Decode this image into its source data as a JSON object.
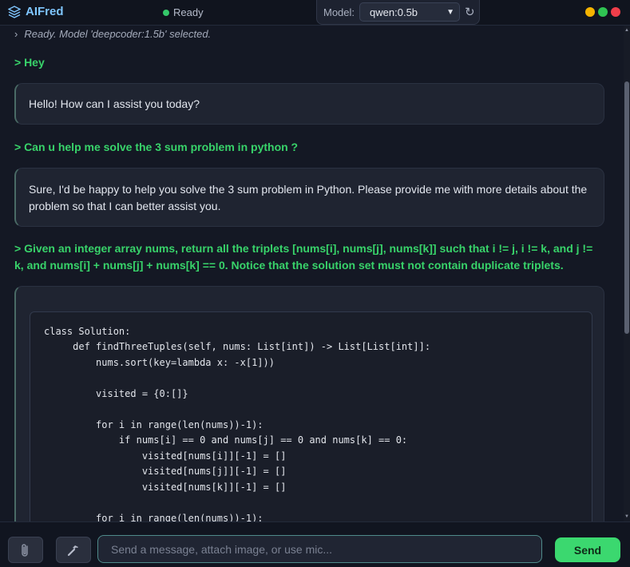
{
  "app": {
    "name": "AIFred"
  },
  "status": {
    "text": "Ready",
    "color": "#35c86a"
  },
  "model_picker": {
    "label": "Model:",
    "selected": "qwen:0.5b"
  },
  "chat": {
    "system_line": "Ready. Model 'deepcoder:1.5b' selected.",
    "messages": [
      {
        "role": "user",
        "text": "> Hey"
      },
      {
        "role": "assistant",
        "text": "Hello! How can I assist you today?"
      },
      {
        "role": "user",
        "text": "> Can u help me solve the 3 sum problem in python ?"
      },
      {
        "role": "assistant",
        "text": "Sure, I'd be happy to help you solve the 3 sum problem in Python. Please provide me with more details about the problem so that I can better assist you."
      },
      {
        "role": "user",
        "text": "> Given an integer array nums, return all the triplets [nums[i], nums[j], nums[k]] such that i != j, i != k, and j != k, and nums[i] + nums[j] + nums[k] == 0. Notice that the solution set must not contain duplicate triplets."
      }
    ],
    "code_lines": [
      "class Solution:",
      "     def findThreeTuples(self, nums: List[int]) -> List[List[int]]:",
      "         nums.sort(key=lambda x: -x[1]))",
      "",
      "         visited = {0:[]}",
      "",
      "         for i in range(len(nums))-1):",
      "             if nums[i] == 0 and nums[j] == 0 and nums[k] == 0:",
      "                 visited[nums[i]][-1] = []",
      "                 visited[nums[j]][-1] = []",
      "                 visited[nums[k]][-1] = []",
      "",
      "         for i in range(len(nums))-1):"
    ]
  },
  "composer": {
    "placeholder": "Send a message, attach image, or use mic...",
    "send_label": "Send"
  },
  "colors": {
    "accent_green": "#38d36a",
    "brand_blue": "#7fc6ff",
    "send_button": "#3bd86f"
  }
}
